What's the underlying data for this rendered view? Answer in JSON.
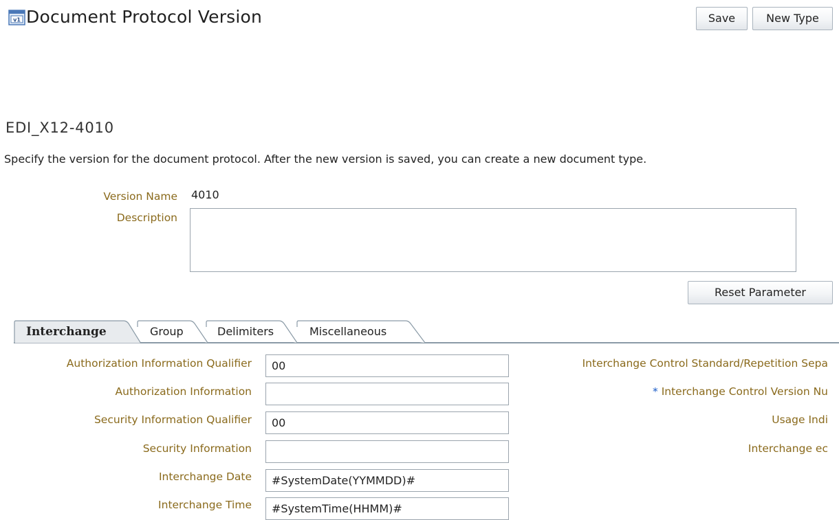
{
  "header": {
    "title": "Document Protocol Version",
    "icon": "document-version-icon",
    "save_label": "Save",
    "new_type_label": "New Type"
  },
  "section": {
    "title": "EDI_X12-4010",
    "instructions": "Specify the version for the document protocol. After the new version is saved, you can create a new document type."
  },
  "form": {
    "version_name_label": "Version Name",
    "version_name_value": "4010",
    "description_label": "Description",
    "description_value": "",
    "reset_label": "Reset Parameter"
  },
  "tabs": [
    {
      "label": "Interchange",
      "selected": true
    },
    {
      "label": "Group",
      "selected": false
    },
    {
      "label": "Delimiters",
      "selected": false
    },
    {
      "label": "Miscellaneous",
      "selected": false
    }
  ],
  "interchange": {
    "left_fields": [
      {
        "label": "Authorization Information Qualifier",
        "value": "00"
      },
      {
        "label": "Authorization Information",
        "value": ""
      },
      {
        "label": "Security Information Qualifier",
        "value": "00"
      },
      {
        "label": "Security Information",
        "value": ""
      },
      {
        "label": "Interchange Date",
        "value": "#SystemDate(YYMMDD)#"
      },
      {
        "label": "Interchange Time",
        "value": "#SystemTime(HHMM)#"
      }
    ],
    "right_fields": [
      {
        "label": "Interchange Control Standard/Repetition Sepa",
        "required": false
      },
      {
        "label": "Interchange Control Version Nu",
        "required": true,
        "required_marker": "*"
      },
      {
        "label": "Usage Indi",
        "required": false
      },
      {
        "label": "Interchange ec",
        "required": false
      }
    ]
  },
  "colors": {
    "label": "#8a6a1c",
    "required_marker": "#1a5cc8",
    "tab_border": "#8a9aa6"
  }
}
